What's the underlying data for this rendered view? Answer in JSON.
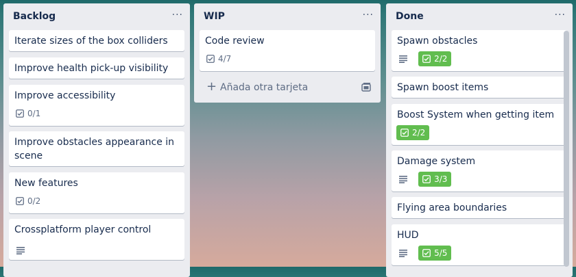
{
  "lists": [
    {
      "title": "Backlog",
      "menu": "···",
      "cards": [
        {
          "title": "Iterate sizes of the box colliders"
        },
        {
          "title": "Improve health pick-up visibility"
        },
        {
          "title": "Improve accessibility",
          "checklist": "0/1"
        },
        {
          "title": "Improve obstacles appearance in scene"
        },
        {
          "title": "New features",
          "checklist": "0/2"
        },
        {
          "title": "Crossplatform player control",
          "description": true
        }
      ]
    },
    {
      "title": "WIP",
      "menu": "···",
      "cards": [
        {
          "title": "Code review",
          "checklist": "4/7"
        }
      ],
      "add_card_label": "Añada otra tarjeta"
    },
    {
      "title": "Done",
      "menu": "···",
      "cards": [
        {
          "title": "Spawn obstacles",
          "description": true,
          "checklist": "2/2",
          "complete": true
        },
        {
          "title": "Spawn boost items"
        },
        {
          "title": "Boost System when getting item",
          "checklist": "2/2",
          "complete": true
        },
        {
          "title": "Damage system",
          "description": true,
          "checklist": "3/3",
          "complete": true
        },
        {
          "title": "Flying area boundaries"
        },
        {
          "title": "HUD",
          "description": true,
          "checklist": "5/5",
          "complete": true
        }
      ]
    }
  ],
  "icons": {
    "checklist": "checkbox-icon",
    "description": "description-icon",
    "add": "plus-icon",
    "template": "card-template-icon"
  },
  "colors": {
    "list_bg": "#ebecf0",
    "card_bg": "#ffffff",
    "complete_badge": "#61bd4f",
    "text": "#172b4d"
  }
}
